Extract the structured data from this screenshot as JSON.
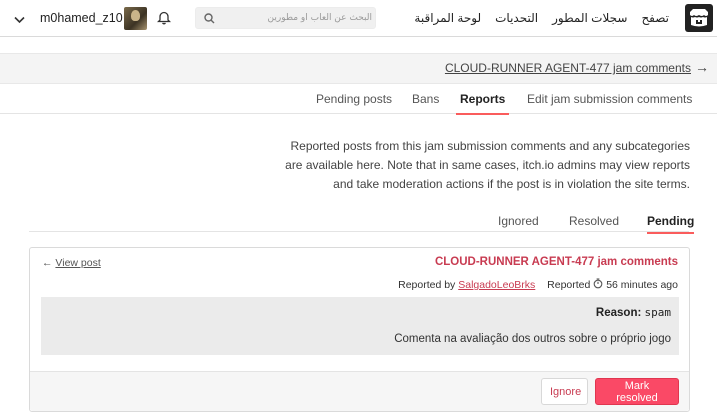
{
  "header": {
    "nav": [
      "تصفح",
      "سجلات المطور",
      "التحديات",
      "لوحة المراقبة"
    ],
    "search_placeholder": "البحث عن ألعاب أو مطورين",
    "username": "m0hamed_z10"
  },
  "breadcrumb": {
    "label": "CLOUD-RUNNER AGENT-477 jam comments",
    "arrow": "→"
  },
  "tabs": [
    "Pending posts",
    "Bans",
    "Reports",
    "Edit jam submission comments"
  ],
  "active_tab": "Reports",
  "description": "Reported posts from this jam submission comments and any subcategories are available here. Note that in same cases, itch.io admins may view reports and take moderation actions if the post is in violation the site terms.",
  "subtabs": [
    "Ignored",
    "Resolved",
    "Pending"
  ],
  "active_subtab": "Pending",
  "report": {
    "view_post": "View post",
    "view_post_arrow": "←",
    "title": "CLOUD-RUNNER AGENT-477 jam comments",
    "reported_by_label": "Reported by",
    "reporter": "SalgadoLeoBrks",
    "reported_label": "Reported",
    "time": "56 minutes ago",
    "reason_label": "Reason:",
    "reason_value": "spam",
    "comment": "Comenta na avaliação dos outros sobre o próprio jogo",
    "ignore_label": "Ignore",
    "resolve_label": "Mark resolved"
  },
  "colors": {
    "accent": "#fa5c5c",
    "link": "#c83b51",
    "button_primary": "#fa4966"
  }
}
